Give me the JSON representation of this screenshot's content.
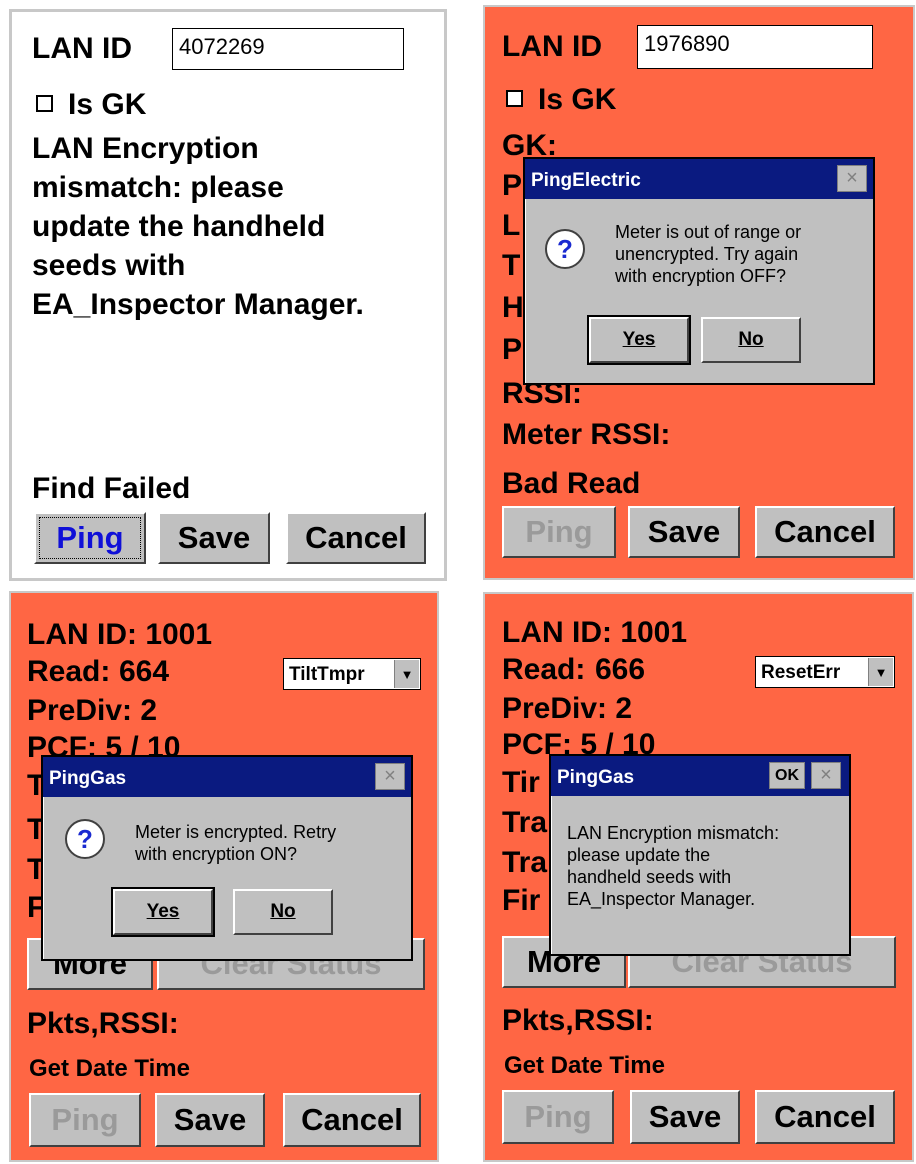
{
  "panel1": {
    "lan_id_label": "LAN ID",
    "lan_id_value": "4072269",
    "is_gk_label": "Is GK",
    "message_lines": [
      "LAN Encryption",
      "mismatch:  please",
      "update the handheld",
      "seeds with",
      "EA_Inspector Manager."
    ],
    "status": "Find Failed",
    "buttons": {
      "ping": "Ping",
      "save": "Save",
      "cancel": "Cancel"
    }
  },
  "panel2": {
    "lan_id_label": "LAN ID",
    "lan_id_value": "1976890",
    "is_gk_label": "Is GK",
    "gk_label": "GK:",
    "partial_labels": [
      "P",
      "L",
      "T",
      "H",
      "P"
    ],
    "rssi_label": "RSSI:",
    "meter_rssi_label": "Meter RSSI:",
    "status": "Bad Read",
    "buttons": {
      "ping": "Ping",
      "save": "Save",
      "cancel": "Cancel"
    },
    "dialog": {
      "title": "PingElectric",
      "close": "×",
      "icon": "?",
      "message": "Meter is out of range or\nunencrypted. Try again\nwith encryption OFF?",
      "yes": "Yes",
      "no": "No"
    }
  },
  "panel3": {
    "lan_id_line": "LAN ID:  1001",
    "read_label": "Read:",
    "read_value": "664",
    "prediv_line": "PreDiv:  2",
    "pcf_line": "PCF:      5 / 10",
    "dropdown_value": "TiltTmpr",
    "partial_labels": [
      "T",
      "T",
      "T",
      "F"
    ],
    "more_button": "More",
    "clear_status_button": "Clear Status",
    "pkts_label": "Pkts,RSSI:",
    "get_date_time": "Get Date Time",
    "buttons": {
      "ping": "Ping",
      "save": "Save",
      "cancel": "Cancel"
    },
    "dialog": {
      "title": "PingGas",
      "close": "×",
      "icon": "?",
      "message": "Meter is encrypted. Retry\nwith encryption ON?",
      "yes": "Yes",
      "no": "No"
    }
  },
  "panel4": {
    "lan_id_line": "LAN ID:  1001",
    "read_label": "Read:",
    "read_value": "666",
    "prediv_line": "PreDiv:  2",
    "pcf_line": "PCF:      5 / 10",
    "dropdown_value": "ResetErr",
    "partial_labels": [
      "Tir",
      "Tra",
      "Tra",
      "Fir"
    ],
    "more_button": "More",
    "clear_status_button": "Clear Status",
    "pkts_label": "Pkts,RSSI:",
    "get_date_time": "Get Date Time",
    "buttons": {
      "ping": "Ping",
      "save": "Save",
      "cancel": "Cancel"
    },
    "dialog": {
      "title": "PingGas",
      "ok": "OK",
      "close": "×",
      "message": "LAN Encryption mismatch:\nplease update the\nhandheld seeds with\nEA_Inspector Manager."
    }
  },
  "colors": {
    "alert_background": "#ff6644",
    "titlebar": "#0a1a80",
    "button_face": "#c0c0c0"
  },
  "icons": [
    "checkbox-icon",
    "question-icon",
    "close-icon",
    "dropdown-arrow-icon"
  ]
}
